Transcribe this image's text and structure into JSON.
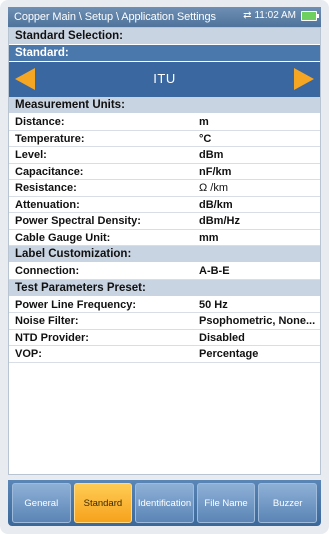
{
  "header": {
    "breadcrumb": "Copper Main \\ Setup \\ Application Settings",
    "time": "11:02 AM"
  },
  "standard_selection": {
    "section": "Standard Selection:",
    "label": "Standard:",
    "value": "ITU"
  },
  "units": {
    "section": "Measurement Units:",
    "rows": [
      {
        "label": "Distance:",
        "value": "m"
      },
      {
        "label": "Temperature:",
        "value": "°C"
      },
      {
        "label": "Level:",
        "value": "dBm"
      },
      {
        "label": "Capacitance:",
        "value": "nF/km"
      },
      {
        "label": "Resistance:",
        "value": "Ω /km"
      },
      {
        "label": "Attenuation:",
        "value": "dB/km"
      },
      {
        "label": "Power Spectral Density:",
        "value": "dBm/Hz"
      },
      {
        "label": "Cable Gauge Unit:",
        "value": "mm"
      }
    ]
  },
  "label_custom": {
    "section": "Label Customization:",
    "rows": [
      {
        "label": "Connection:",
        "value": "A-B-E"
      }
    ]
  },
  "test_params": {
    "section": "Test Parameters Preset:",
    "rows": [
      {
        "label": "Power Line Frequency:",
        "value": "50 Hz"
      },
      {
        "label": "Noise Filter:",
        "value": "Psophometric, None..."
      },
      {
        "label": "NTD Provider:",
        "value": "Disabled"
      },
      {
        "label": "VOP:",
        "value": "Percentage"
      }
    ]
  },
  "tabs": [
    {
      "label": "General"
    },
    {
      "label": "Standard",
      "active": true
    },
    {
      "label": "Identification"
    },
    {
      "label": "File Name"
    },
    {
      "label": "Buzzer"
    }
  ],
  "colors": {
    "accent": "#f6a21c",
    "header": "#4f739c"
  }
}
